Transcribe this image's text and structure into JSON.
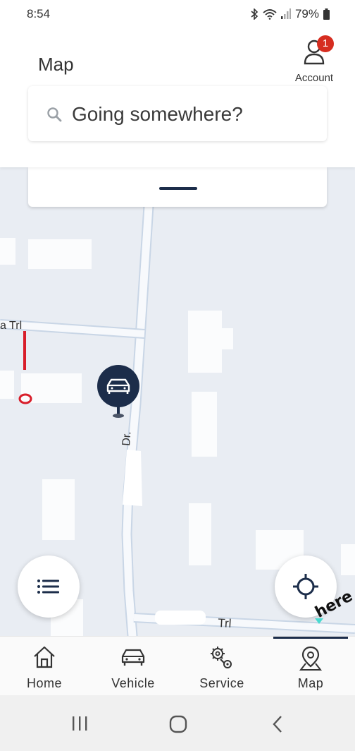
{
  "status_bar": {
    "time": "8:54",
    "battery_percent": "79%"
  },
  "header": {
    "title": "Map",
    "account_label": "Account",
    "account_badge_count": "1"
  },
  "search": {
    "placeholder": "Going somewhere?"
  },
  "map": {
    "street_labels": {
      "top_left": "a Trl",
      "vertical": "Dr.",
      "bottom": "Trl"
    },
    "attribution": "here"
  },
  "bottom_nav": {
    "items": [
      {
        "label": "Home",
        "icon": "home-icon"
      },
      {
        "label": "Vehicle",
        "icon": "car-icon"
      },
      {
        "label": "Service",
        "icon": "service-icon"
      },
      {
        "label": "Map",
        "icon": "map-pin-icon",
        "active": true
      }
    ]
  },
  "colors": {
    "accent": "#1c2d4a",
    "badge": "#d62d20",
    "map_bg": "#e9edf3",
    "road": "#c9d6e6"
  }
}
